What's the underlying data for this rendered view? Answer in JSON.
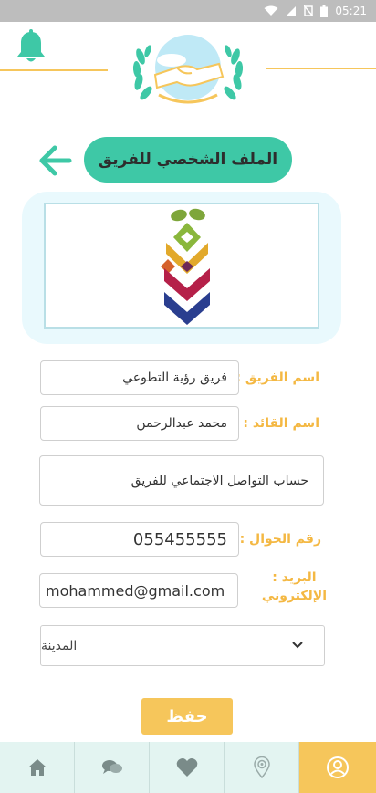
{
  "status_bar": {
    "time": "05:21",
    "icons": [
      "wifi-icon",
      "signal-icon",
      "no-sim-icon",
      "battery-icon"
    ]
  },
  "header": {
    "bell_icon": "bell-icon",
    "logo_icon": "volunteer-hands-laurel-logo"
  },
  "page": {
    "title": "الملف الشخصي للفريق",
    "back_icon": "arrow-left-icon"
  },
  "team_image": {
    "icon": "team-emblem-logo"
  },
  "form": {
    "team_name": {
      "label": "اسم الفريق :",
      "value": "فريق رؤية التطوعي"
    },
    "leader_name": {
      "label": "اسم القائد :",
      "value": "محمد عبدالرحمن"
    },
    "social_account": {
      "placeholder": "حساب التواصل الاجتماعي للفريق"
    },
    "mobile": {
      "label": "رقم الجوال :",
      "value": "055455555"
    },
    "email": {
      "label_line1": "البريد :",
      "label_line2": "الإلكتروني",
      "value": "mohammed@gmail.com"
    },
    "city": {
      "selected": "المدينة"
    },
    "save_label": "حفظ"
  },
  "nav": {
    "items": [
      "home-icon",
      "chat-icon",
      "heart-icon",
      "location-icon",
      "profile-icon"
    ],
    "active": "profile-icon"
  },
  "colors": {
    "accent_green": "#3ec8a6",
    "accent_yellow": "#f6c65b",
    "label_orange": "#f4b843"
  }
}
